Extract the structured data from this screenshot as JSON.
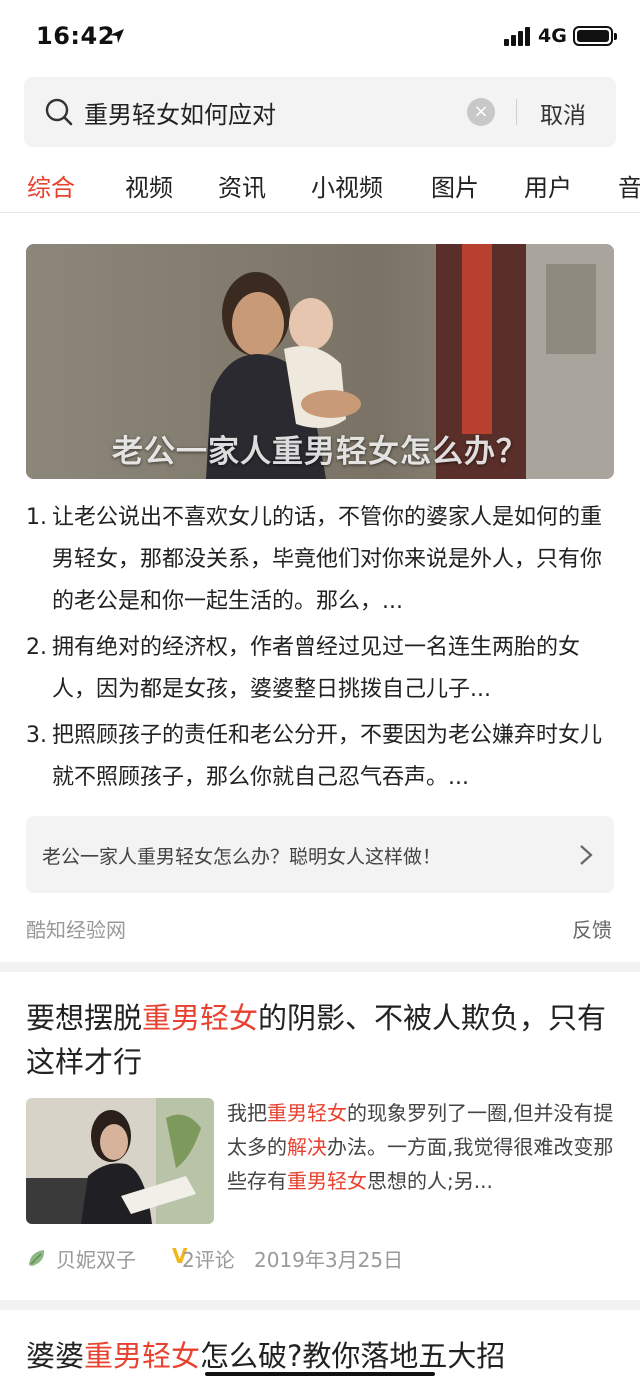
{
  "status": {
    "time": "16:42",
    "network": "4G"
  },
  "search": {
    "query": "重男轻女如何应对",
    "cancel_label": "取消"
  },
  "tabs": [
    {
      "label": "综合",
      "active": true
    },
    {
      "label": "视频"
    },
    {
      "label": "资讯"
    },
    {
      "label": "小视频"
    },
    {
      "label": "图片"
    },
    {
      "label": "用户"
    },
    {
      "label": "音"
    }
  ],
  "result1": {
    "image_caption": "老公一家人重男轻女怎么办？",
    "items": [
      {
        "num": "1.",
        "text": "让老公说出不喜欢女儿的话，不管你的婆家人是如何的重男轻女，那都没关系，毕竟他们对你来说是外人，只有你的老公是和你一起生活的。那么，..."
      },
      {
        "num": "2.",
        "text": "拥有绝对的经济权，作者曾经过见过一名连生两胎的女人，因为都是女孩，婆婆整日挑拨自己儿子..."
      },
      {
        "num": "3.",
        "text": "把照顾孩子的责任和老公分开，不要因为老公嫌弃时女儿就不照顾孩子，那么你就自己忍气吞声。..."
      }
    ],
    "related_link": "老公一家人重男轻女怎么办？聪明女人这样做！",
    "source": "酷知经验网",
    "feedback": "反馈"
  },
  "result2": {
    "title_parts": [
      "要想摆脱",
      "重男轻女",
      "的阴影、不被人欺负，只有这样才行"
    ],
    "snippet_parts": [
      "我把",
      "重男轻女",
      "的现象罗列了一圈,但并没有提太多的",
      "解决",
      "办法。一方面,我觉得很难改变那些存有",
      "重男轻女",
      "思想的人;另..."
    ],
    "author": "贝妮双子",
    "comments": "2评论",
    "date": "2019年3月25日"
  },
  "result3": {
    "title_parts": [
      "婆婆",
      "重男轻女",
      "怎么破?教你落地五大招"
    ]
  },
  "colors": {
    "accent": "#e8412f",
    "verified": "#f2b51c"
  }
}
